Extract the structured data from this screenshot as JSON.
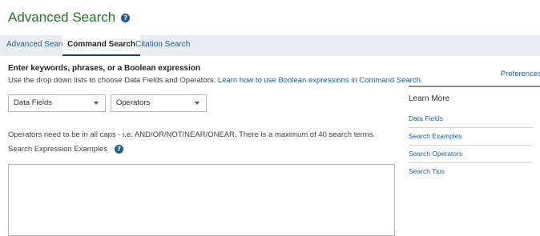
{
  "header": {
    "title": "Advanced Search",
    "help_glyph": "?"
  },
  "tabs": [
    {
      "label": "Advanced Search",
      "active": false
    },
    {
      "label": "Command Search",
      "active": true
    },
    {
      "label": "Citation Search",
      "active": false
    }
  ],
  "instructions": {
    "heading": "Enter keywords, phrases, or a Boolean expression",
    "text": "Use the drop down lists to choose Data Fields and Operators.",
    "link": "Learn how to use Boolean expressions in Command Search."
  },
  "dropdowns": {
    "data_fields": "Data Fields",
    "operators": "Operators"
  },
  "operators_note": "Operators need to be in all caps - i.e. AND/OR/NOT/NEAR/ONEAR. There is a maximum of 40 search terms.",
  "examples_label": "Search Expression Examples",
  "search_box": {
    "value": ""
  },
  "preferences_label": "Preferences",
  "learn_more": {
    "title": "Learn More",
    "links": [
      "Data Fields",
      "Search Examples",
      "Search Operators",
      "Search Tips"
    ]
  },
  "colors": {
    "title_green": "#2d6e2e",
    "link_blue": "#1f5d99",
    "tab_bar": "#e9eef4"
  }
}
